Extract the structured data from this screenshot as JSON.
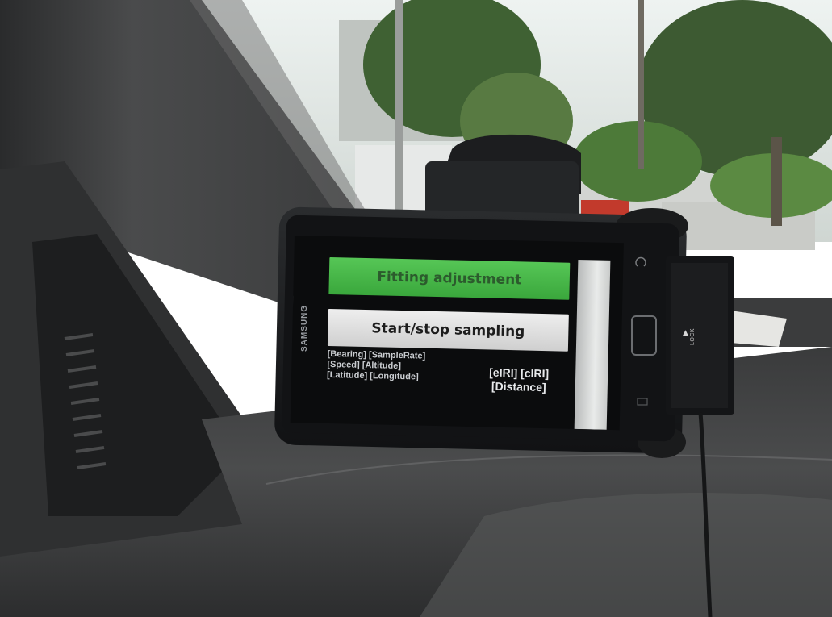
{
  "phone": {
    "brand": "SAMSUNG",
    "screen": {
      "fitting_button_label": "Fitting adjustment",
      "sampling_button_label": "Start/stop sampling",
      "info_left": [
        "[Bearing] [SampleRate]",
        "[Speed] [Altitude]",
        "[Latitude] [Longitude]"
      ],
      "info_right": [
        "[eIRI] [cIRI]",
        "[Distance]"
      ]
    }
  },
  "mount": {
    "lock_label": "LOCK"
  },
  "colors": {
    "fitting_button": "#3fb043",
    "sampling_button": "#dcdcdc",
    "screen_background": "#0b0c0d"
  }
}
